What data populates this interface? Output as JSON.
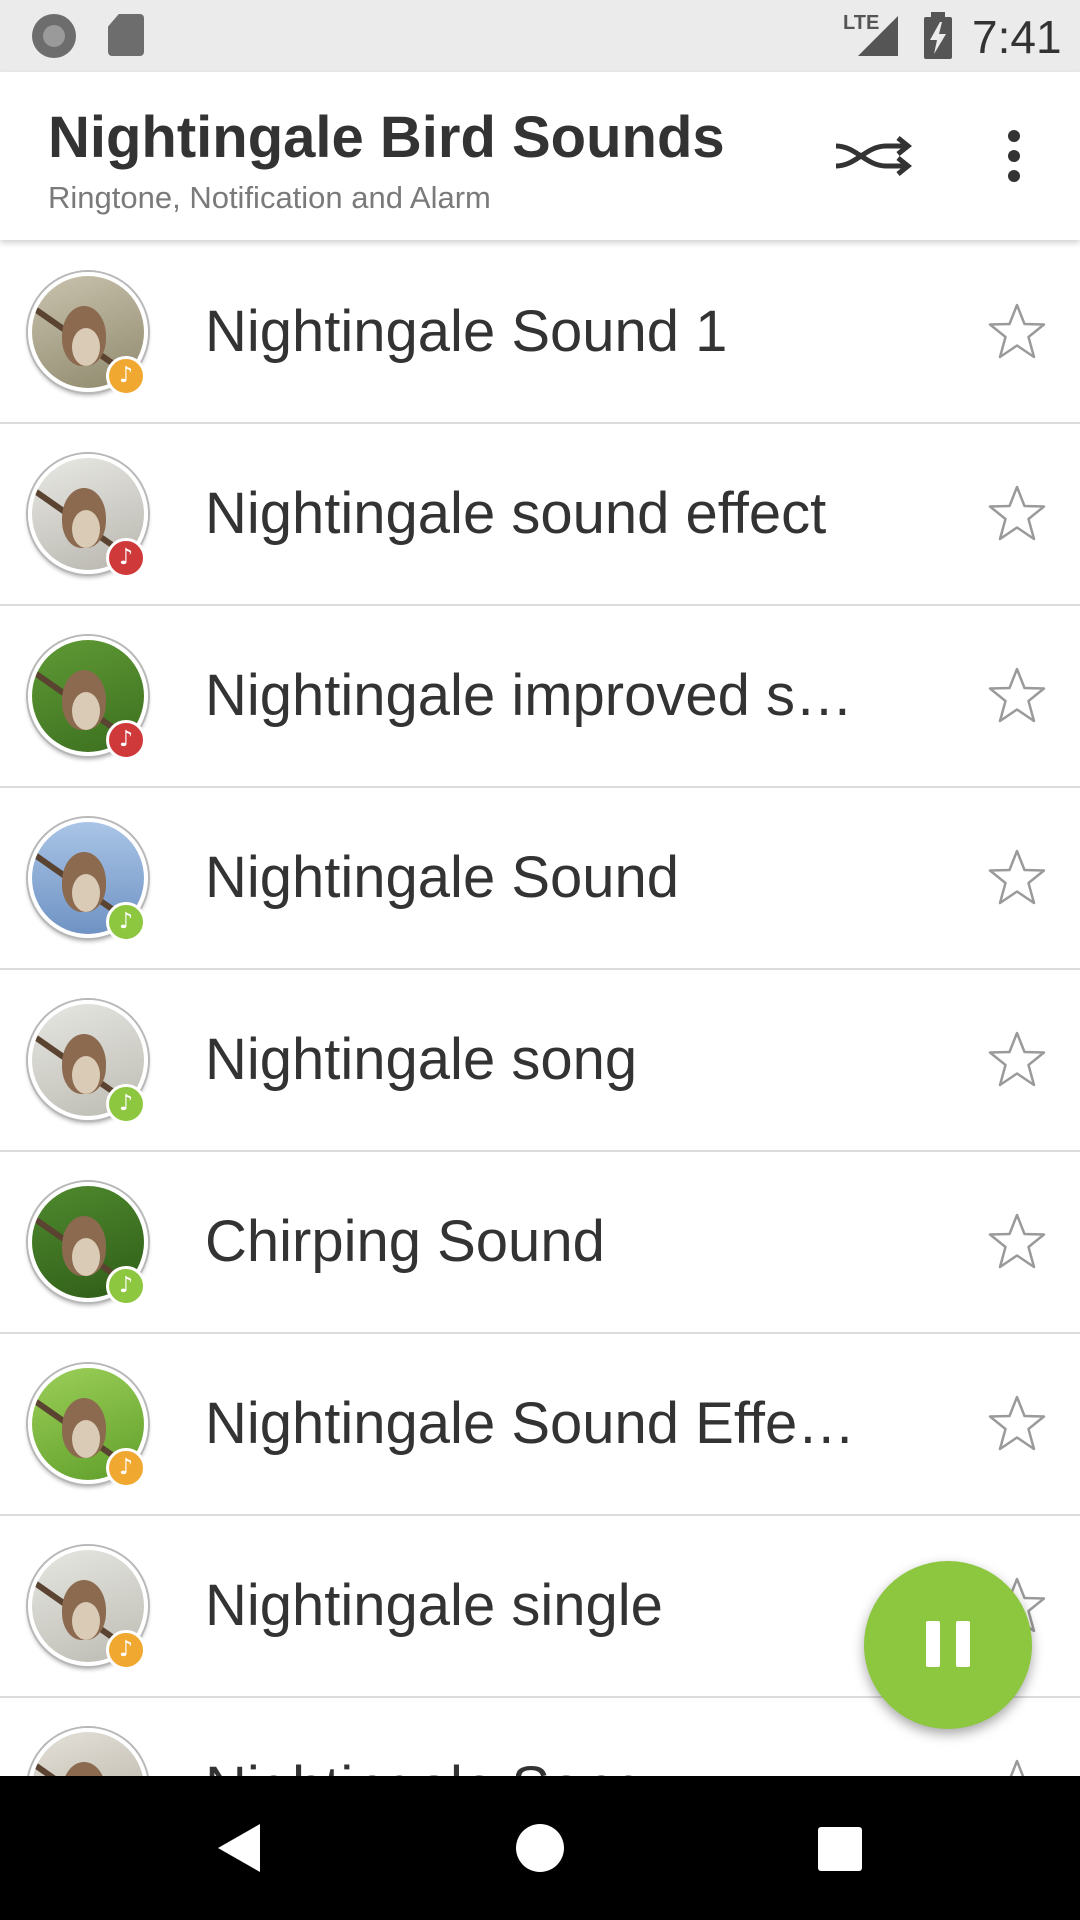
{
  "status_bar": {
    "time": "7:41",
    "network": "LTE",
    "icons": [
      "circle-notification-icon",
      "sd-card-icon",
      "signal-icon",
      "battery-charging-icon"
    ]
  },
  "app_bar": {
    "title": "Nightingale Bird Sounds",
    "subtitle": "Ringtone, Notification and Alarm",
    "actions": [
      "shuffle-icon",
      "more-vert-icon"
    ]
  },
  "list": {
    "items": [
      {
        "title": "Nightingale Sound 1",
        "badge_color": "#f0a830"
      },
      {
        "title": "Nightingale sound effect",
        "badge_color": "#d0393a"
      },
      {
        "title": "Nightingale improved sound",
        "badge_color": "#d0393a"
      },
      {
        "title": "Nightingale Sound",
        "badge_color": "#8dc63f"
      },
      {
        "title": "Nightingale song",
        "badge_color": "#8dc63f"
      },
      {
        "title": "Chirping Sound",
        "badge_color": "#8dc63f"
      },
      {
        "title": "Nightingale Sound Effects",
        "badge_color": "#f0a830"
      },
      {
        "title": "Nightingale single",
        "badge_color": "#f0a830"
      },
      {
        "title": "Nightingale Song",
        "badge_color": "#f0a830"
      }
    ]
  },
  "fab": {
    "icon": "pause-icon",
    "color": "#8dc63f"
  },
  "nav_bar": {
    "icons": [
      "back-icon",
      "home-icon",
      "recents-icon"
    ]
  },
  "colors": {
    "accent": "#8dc63f",
    "orange": "#f0a830",
    "red": "#d0393a"
  }
}
